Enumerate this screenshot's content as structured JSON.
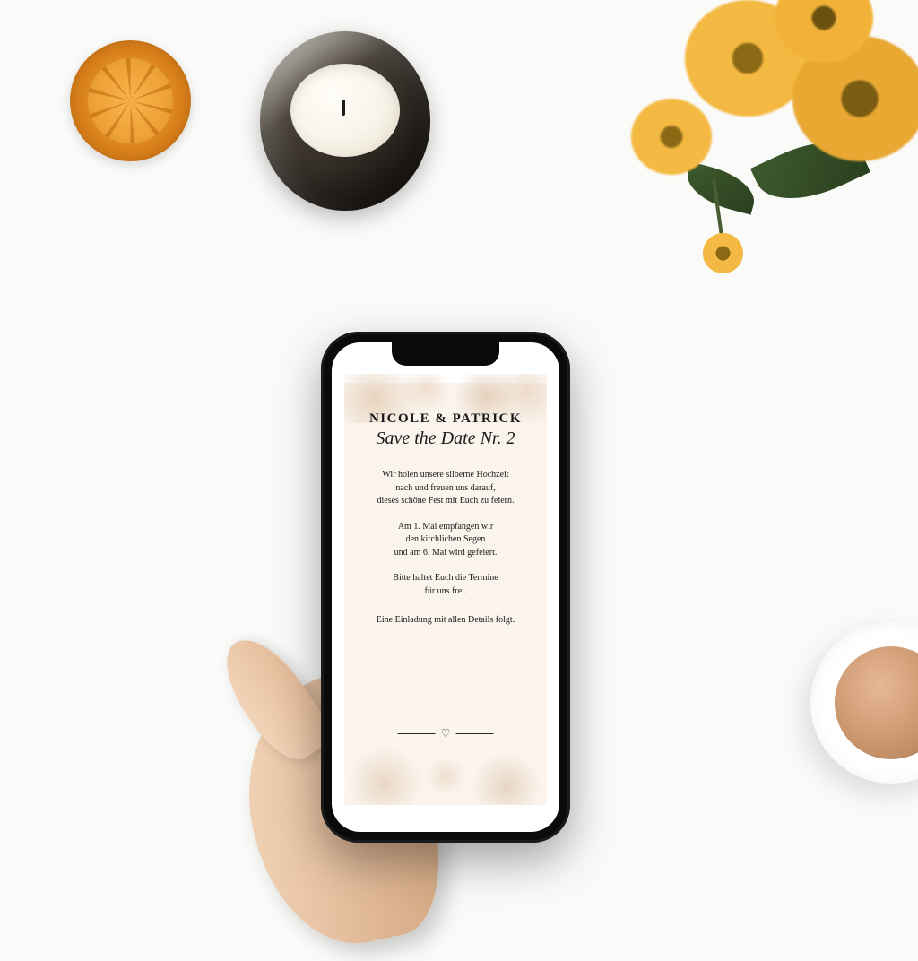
{
  "props": {
    "orange_slice": "dried-orange-slice",
    "candle": "candle-in-amber-jar",
    "flowers": "yellow-sunflowers",
    "cup": "coffee-cup"
  },
  "phone": {
    "device": "smartphone-black",
    "invitation": {
      "names": "NICOLE & PATRICK",
      "subtitle": "Save the Date Nr. 2",
      "para1_l1": "Wir holen unsere silberne Hochzeit",
      "para1_l2": "nach und freuen uns darauf,",
      "para1_l3": "dieses schöne Fest mit Euch zu feiern.",
      "para2_l1": "Am 1. Mai  empfangen wir",
      "para2_l2": "den kirchlichen Segen",
      "para2_l3": "und am 6. Mai wird gefeiert.",
      "para3_l1": "Bitte haltet Euch die Termine",
      "para3_l2": "für uns frei.",
      "para4": "Eine Einladung mit allen Details folgt.",
      "heart_glyph": "♡"
    }
  }
}
